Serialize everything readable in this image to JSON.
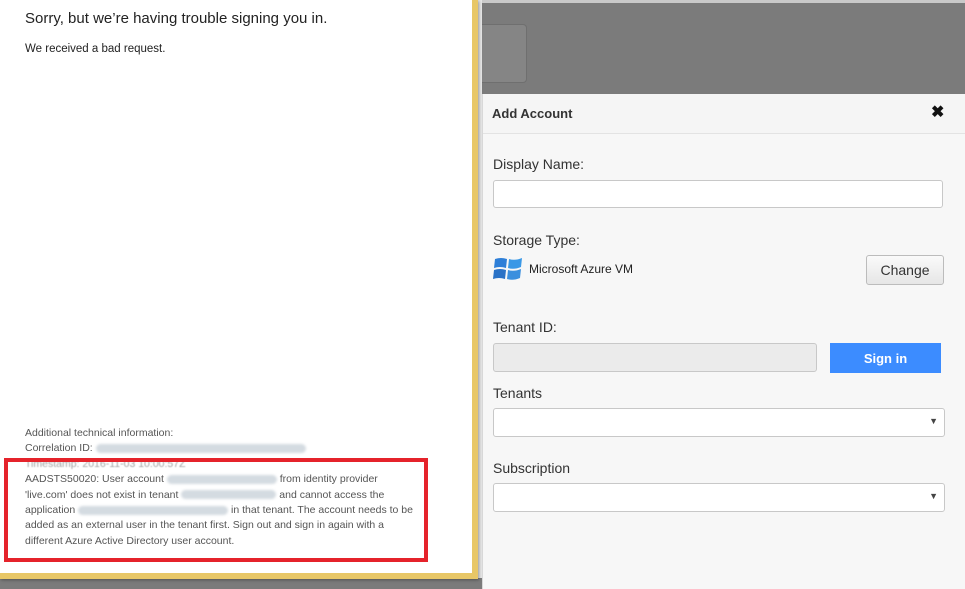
{
  "error": {
    "title": "Sorry, but we’re having trouble signing you in.",
    "subtitle": "We received a bad request.",
    "tech_heading": "Additional technical information:",
    "correlation_label": "Correlation ID:",
    "timestamp_line": "Timestamp: 2016-11-03 10:00:57Z",
    "msg_part1": "AADSTS50020: User account",
    "msg_part2": "from identity provider 'live.com' does not exist in tenant",
    "msg_part3": "and cannot access the application",
    "msg_part4": "in that tenant. The account needs to be added as an external user in the tenant first. Sign out and sign in again with a different Azure Active Directory user account."
  },
  "panel": {
    "title": "Add Account",
    "display_name_label": "Display Name:",
    "display_name_value": "",
    "storage_type_label": "Storage Type:",
    "storage_type_value": "Microsoft Azure VM",
    "storage_icon": "windows-logo-icon",
    "change_label": "Change",
    "tenant_id_label": "Tenant ID:",
    "tenant_id_value": "",
    "sign_in_label": "Sign in",
    "tenants_label": "Tenants",
    "tenants_selected": "",
    "subscription_label": "Subscription",
    "subscription_selected": ""
  },
  "colors": {
    "accent_button": "#3c8cff",
    "dialog_border": "#e8c767",
    "highlight": "#e5232b"
  }
}
